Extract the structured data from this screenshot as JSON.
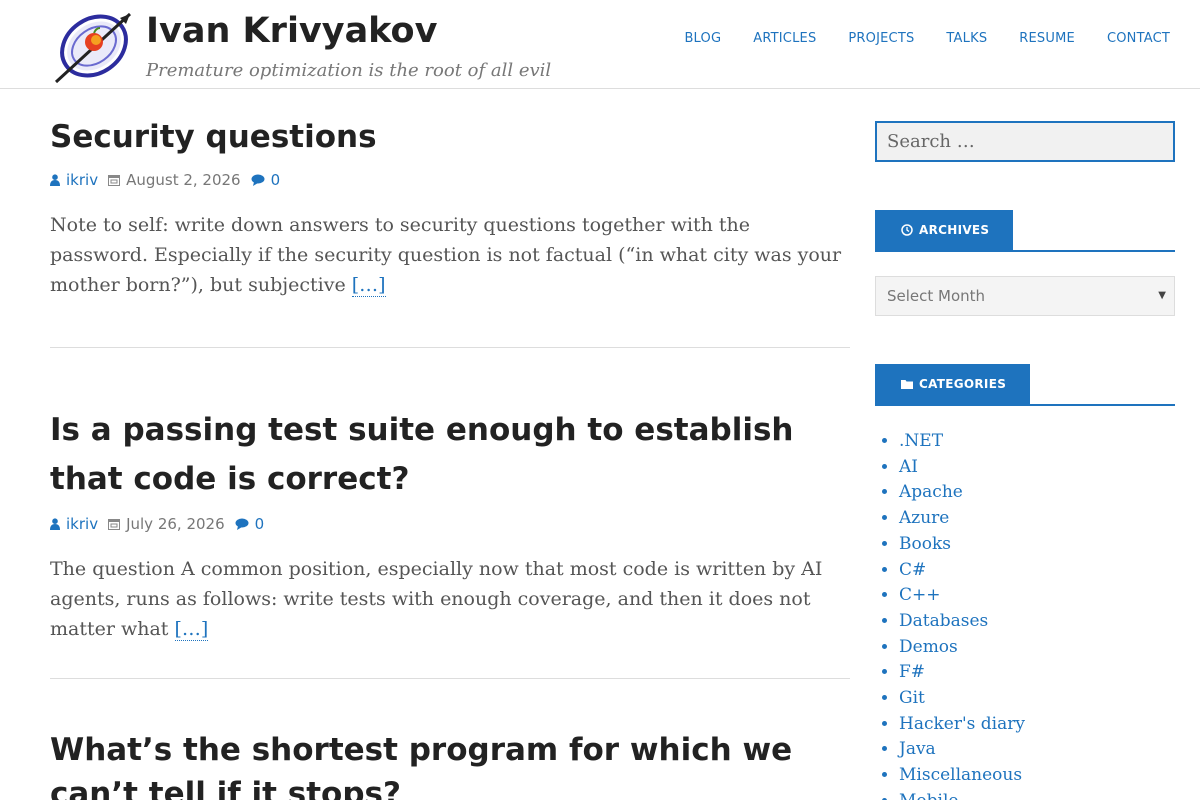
{
  "site": {
    "title": "Ivan Krivyakov",
    "tagline": "Premature optimization is the root of all evil"
  },
  "nav": [
    "BLOG",
    "ARTICLES",
    "PROJECTS",
    "TALKS",
    "RESUME",
    "CONTACT"
  ],
  "posts": [
    {
      "title": "Security questions",
      "author": "ikriv",
      "date": "August 2, 2026",
      "comments": "0",
      "excerpt": "Note to self: write down answers to security questions together with the password. Especially if the security question is not factual (“in what city was your mother born?”), but subjective",
      "more": "[…]"
    },
    {
      "title": "Is a passing test suite enough to establish that code is correct?",
      "author": "ikriv",
      "date": "July 26, 2026",
      "comments": "0",
      "excerpt": "The question A common position, especially now that most code is written by AI agents, runs as follows: write tests with enough coverage, and then it does not matter what",
      "more": "[…]"
    },
    {
      "title": "What’s the shortest program for which we can’t tell if it stops?"
    }
  ],
  "sidebar": {
    "search_placeholder": "Search …",
    "archives_title": "ARCHIVES",
    "archives_select": "Select Month",
    "categories_title": "CATEGORIES",
    "categories": [
      ".NET",
      "AI",
      "Apache",
      "Azure",
      "Books",
      "C#",
      "C++",
      "Databases",
      "Demos",
      "F#",
      "Git",
      "Hacker's diary",
      "Java",
      "Miscellaneous",
      "Mobile"
    ]
  },
  "colors": {
    "accent": "#1e73be",
    "text": "#222222",
    "muted": "#777777"
  },
  "icons": [
    "author-icon",
    "calendar-icon",
    "comment-icon",
    "clock-icon",
    "folder-icon",
    "logo-icon"
  ]
}
